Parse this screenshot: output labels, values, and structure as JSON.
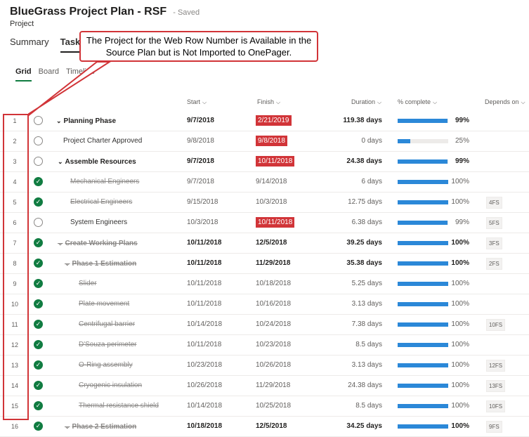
{
  "header": {
    "title": "BlueGrass Project Plan - RSF",
    "saved": "Saved",
    "subtitle": "Project"
  },
  "tabs": [
    {
      "label": "Summary"
    },
    {
      "label": "Tasks"
    }
  ],
  "subtabs": [
    {
      "label": "Grid"
    },
    {
      "label": "Board"
    },
    {
      "label": "Timeline"
    }
  ],
  "callout": {
    "text": "The Project for the Web Row Number is Available in the Source Plan but is Not Imported to OnePager."
  },
  "columns": {
    "start": "Start",
    "finish": "Finish",
    "duration": "Duration",
    "percent": "% complete",
    "depends": "Depends on"
  },
  "colors": {
    "accent_green": "#107c41",
    "late_red": "#d13438",
    "bar_blue": "#2b88d8"
  },
  "rows": [
    {
      "num": "1",
      "name": "Planning Phase",
      "start": "9/7/2018",
      "finish": "2/21/2019",
      "duration": "119.38 days",
      "percent": "99%",
      "progress": 0.99,
      "depends": ""
    },
    {
      "num": "2",
      "name": "Project Charter Approved",
      "start": "9/8/2018",
      "finish": "9/8/2018",
      "duration": "0 days",
      "percent": "25%",
      "progress": 0.25,
      "depends": ""
    },
    {
      "num": "3",
      "name": "Assemble Resources",
      "start": "9/7/2018",
      "finish": "10/11/2018",
      "duration": "24.38 days",
      "percent": "99%",
      "progress": 0.99,
      "depends": ""
    },
    {
      "num": "4",
      "name": "Mechanical Engineers",
      "start": "9/7/2018",
      "finish": "9/14/2018",
      "duration": "6 days",
      "percent": "100%",
      "progress": 1,
      "depends": ""
    },
    {
      "num": "5",
      "name": "Electrical Engineers",
      "start": "9/15/2018",
      "finish": "10/3/2018",
      "duration": "12.75 days",
      "percent": "100%",
      "progress": 1,
      "depends": "4FS"
    },
    {
      "num": "6",
      "name": "System Engineers",
      "start": "10/3/2018",
      "finish": "10/11/2018",
      "duration": "6.38 days",
      "percent": "99%",
      "progress": 0.99,
      "depends": "5FS"
    },
    {
      "num": "7",
      "name": "Create Working Plans",
      "start": "10/11/2018",
      "finish": "12/5/2018",
      "duration": "39.25 days",
      "percent": "100%",
      "progress": 1,
      "depends": "3FS"
    },
    {
      "num": "8",
      "name": "Phase 1 Estimation",
      "start": "10/11/2018",
      "finish": "11/29/2018",
      "duration": "35.38 days",
      "percent": "100%",
      "progress": 1,
      "depends": "2FS"
    },
    {
      "num": "9",
      "name": "Slider",
      "start": "10/11/2018",
      "finish": "10/18/2018",
      "duration": "5.25 days",
      "percent": "100%",
      "progress": 1,
      "depends": ""
    },
    {
      "num": "10",
      "name": "Plate movement",
      "start": "10/11/2018",
      "finish": "10/16/2018",
      "duration": "3.13 days",
      "percent": "100%",
      "progress": 1,
      "depends": ""
    },
    {
      "num": "11",
      "name": "Centrifugal barrier",
      "start": "10/14/2018",
      "finish": "10/24/2018",
      "duration": "7.38 days",
      "percent": "100%",
      "progress": 1,
      "depends": "10FS"
    },
    {
      "num": "12",
      "name": "D'Souza perimeter",
      "start": "10/11/2018",
      "finish": "10/23/2018",
      "duration": "8.5 days",
      "percent": "100%",
      "progress": 1,
      "depends": ""
    },
    {
      "num": "13",
      "name": "O-Ring assembly",
      "start": "10/23/2018",
      "finish": "10/26/2018",
      "duration": "3.13 days",
      "percent": "100%",
      "progress": 1,
      "depends": "12FS"
    },
    {
      "num": "14",
      "name": "Cryogenic insulation",
      "start": "10/26/2018",
      "finish": "11/29/2018",
      "duration": "24.38 days",
      "percent": "100%",
      "progress": 1,
      "depends": "13FS"
    },
    {
      "num": "15",
      "name": "Thermal resistance shield",
      "start": "10/14/2018",
      "finish": "10/25/2018",
      "duration": "8.5 days",
      "percent": "100%",
      "progress": 1,
      "depends": "10FS"
    },
    {
      "num": "16",
      "name": "Phase 2 Estimation",
      "start": "10/18/2018",
      "finish": "12/5/2018",
      "duration": "34.25 days",
      "percent": "100%",
      "progress": 1,
      "depends": "9FS"
    }
  ]
}
